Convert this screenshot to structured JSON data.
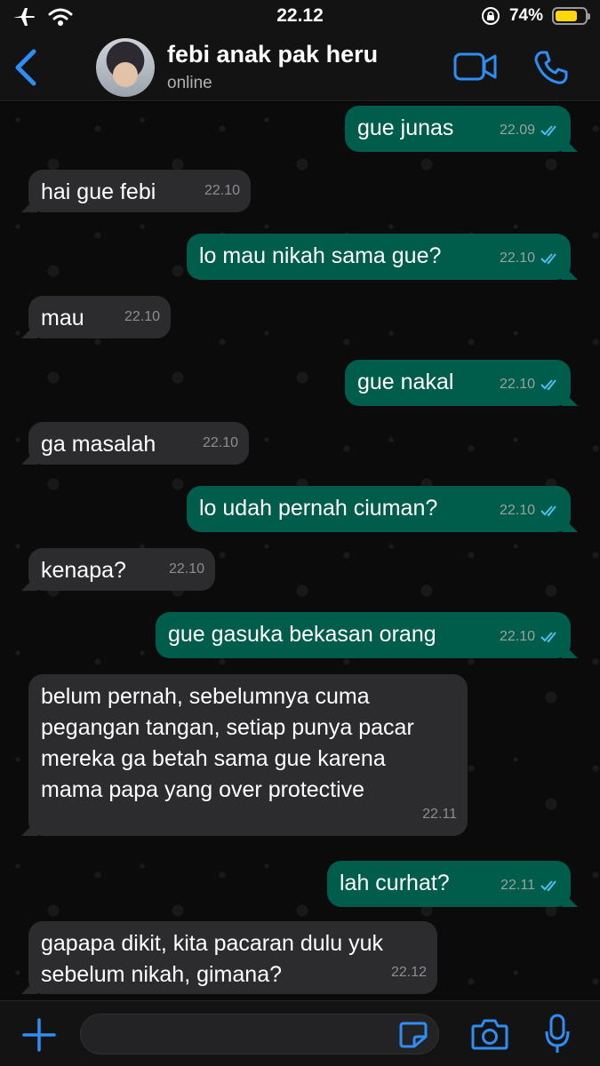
{
  "status_bar": {
    "time": "22.12",
    "battery_percent": "74%",
    "battery_level": 0.74,
    "icons": [
      "airplane-icon",
      "wifi-icon",
      "orientation-lock-icon",
      "battery-icon"
    ]
  },
  "header": {
    "contact_name": "febi anak pak heru",
    "contact_status": "online",
    "icons": [
      "back-chevron-icon",
      "avatar",
      "video-call-icon",
      "phone-icon"
    ],
    "accent_color": "#2f8ef5"
  },
  "messages": [
    {
      "direction": "out",
      "text": "gue junas",
      "time": "22.09"
    },
    {
      "direction": "in",
      "text": "hai gue febi",
      "time": "22.10"
    },
    {
      "direction": "out",
      "text": "lo mau nikah sama gue?",
      "time": "22.10"
    },
    {
      "direction": "in",
      "text": "mau",
      "time": "22.10"
    },
    {
      "direction": "out",
      "text": "gue nakal",
      "time": "22.10"
    },
    {
      "direction": "in",
      "text": "ga masalah",
      "time": "22.10"
    },
    {
      "direction": "out",
      "text": "lo udah pernah ciuman?",
      "time": "22.10"
    },
    {
      "direction": "in",
      "text": "kenapa?",
      "time": "22.10"
    },
    {
      "direction": "out",
      "text": "gue gasuka bekasan orang",
      "time": "22.10"
    },
    {
      "direction": "in",
      "text": "belum pernah, sebelumnya cuma pegangan tangan, setiap punya pacar mereka ga betah sama gue karena mama papa yang over protective",
      "time": "22.11"
    },
    {
      "direction": "out",
      "text": "lah curhat?",
      "time": "22.11"
    },
    {
      "direction": "in",
      "text": "gapapa dikit, kita pacaran dulu yuk sebelum nikah, gimana?",
      "time": "22.12"
    }
  ],
  "colors": {
    "outgoing_bubble": "#005c4b",
    "incoming_bubble": "#2c2c2e",
    "read_ticks": "#53bdeb"
  },
  "input_bar": {
    "icons": [
      "plus-icon",
      "sticker-icon",
      "camera-icon",
      "microphone-icon"
    ]
  }
}
